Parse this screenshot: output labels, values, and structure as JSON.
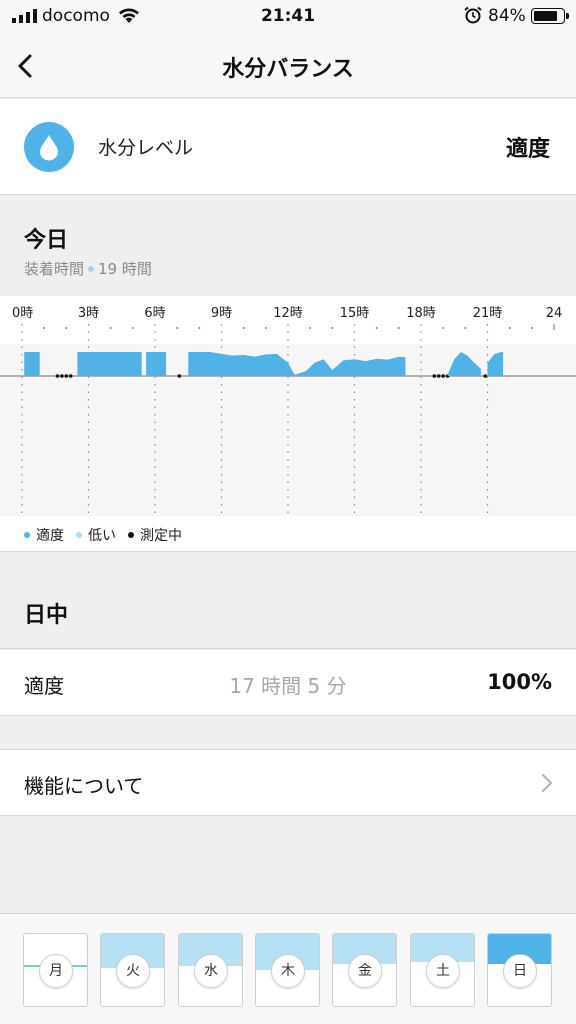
{
  "status_bar": {
    "carrier": "docomo",
    "time": "21:41",
    "battery": "84%",
    "battery_level": 0.84,
    "icons": [
      "signal-icon",
      "wifi-icon",
      "alarm-icon",
      "battery-icon"
    ]
  },
  "nav": {
    "title": "水分バランス",
    "back_icon": "chevron-left-icon"
  },
  "level": {
    "label": "水分レベル",
    "value": "適度",
    "icon": "water-drop-icon",
    "accent": "#4fb3e8"
  },
  "today": {
    "heading": "今日",
    "worn_label": "装着時間",
    "worn_value": "19 時間"
  },
  "chart_data": {
    "type": "area",
    "x_ticks": [
      "0時",
      "3時",
      "6時",
      "9時",
      "12時",
      "15時",
      "18時",
      "21時",
      "24"
    ],
    "xlim": [
      0,
      24
    ],
    "grid": true,
    "segments": [
      {
        "status": "適度",
        "x": [
          0.1,
          0.8
        ],
        "y": [
          1,
          1
        ]
      },
      {
        "status": "測定中",
        "x": [
          1.6,
          2.2
        ],
        "y": [
          0,
          0
        ]
      },
      {
        "status": "適度",
        "x": [
          2.5,
          5.4
        ],
        "y": [
          1,
          1
        ]
      },
      {
        "status": "適度",
        "x": [
          5.6,
          6.5
        ],
        "y": [
          1,
          1
        ]
      },
      {
        "status": "測定中",
        "x": [
          7.1,
          7.2
        ],
        "y": [
          0,
          0
        ]
      },
      {
        "status": "適度",
        "x": [
          7.5,
          8.5,
          9.0,
          9.5,
          10.0,
          10.5,
          11.0,
          11.5,
          12.0,
          12.3,
          12.8,
          13.2,
          13.6,
          14.0,
          14.5,
          15.0,
          15.5,
          16.0,
          16.5,
          17.0,
          17.3
        ],
        "y": [
          1.0,
          1.0,
          0.92,
          0.85,
          0.88,
          0.8,
          0.9,
          0.92,
          0.55,
          0.05,
          0.2,
          0.55,
          0.7,
          0.25,
          0.65,
          0.7,
          0.62,
          0.72,
          0.68,
          0.8,
          0.78
        ]
      },
      {
        "status": "測定中",
        "x": [
          18.6,
          19.2
        ],
        "y": [
          0,
          0
        ]
      },
      {
        "status": "適度",
        "x": [
          19.2,
          19.5,
          19.8,
          20.1,
          20.4,
          20.7
        ],
        "y": [
          0.05,
          0.7,
          1.0,
          0.85,
          0.55,
          0.3
        ]
      },
      {
        "status": "測定中",
        "x": [
          20.9,
          20.95
        ],
        "y": [
          0,
          0
        ]
      },
      {
        "status": "適度",
        "x": [
          21.0,
          21.3,
          21.6,
          21.7
        ],
        "y": [
          0.55,
          0.9,
          1.0,
          1.0
        ]
      }
    ],
    "colors": {
      "適度": "#4fb3e8",
      "低い": "#a8dcf5",
      "測定中": "#111111"
    }
  },
  "legend": [
    {
      "label": "適度",
      "color": "#4fb3e8"
    },
    {
      "label": "低い",
      "color": "#a8dcf5"
    },
    {
      "label": "測定中",
      "color": "#111111"
    }
  ],
  "daytime": {
    "heading": "日中",
    "row_label": "適度",
    "duration": "17 時間 5 分",
    "percent": "100%"
  },
  "about": {
    "label": "機能について",
    "chevron": "chevron-right-icon"
  },
  "week": [
    {
      "label": "月",
      "level": 0.0,
      "selected": false
    },
    {
      "label": "火",
      "level": 0.68,
      "selected": false
    },
    {
      "label": "水",
      "level": 0.64,
      "selected": false
    },
    {
      "label": "木",
      "level": 0.72,
      "selected": false
    },
    {
      "label": "金",
      "level": 0.6,
      "selected": false
    },
    {
      "label": "土",
      "level": 0.55,
      "selected": false
    },
    {
      "label": "日",
      "level": 0.6,
      "selected": true
    }
  ]
}
